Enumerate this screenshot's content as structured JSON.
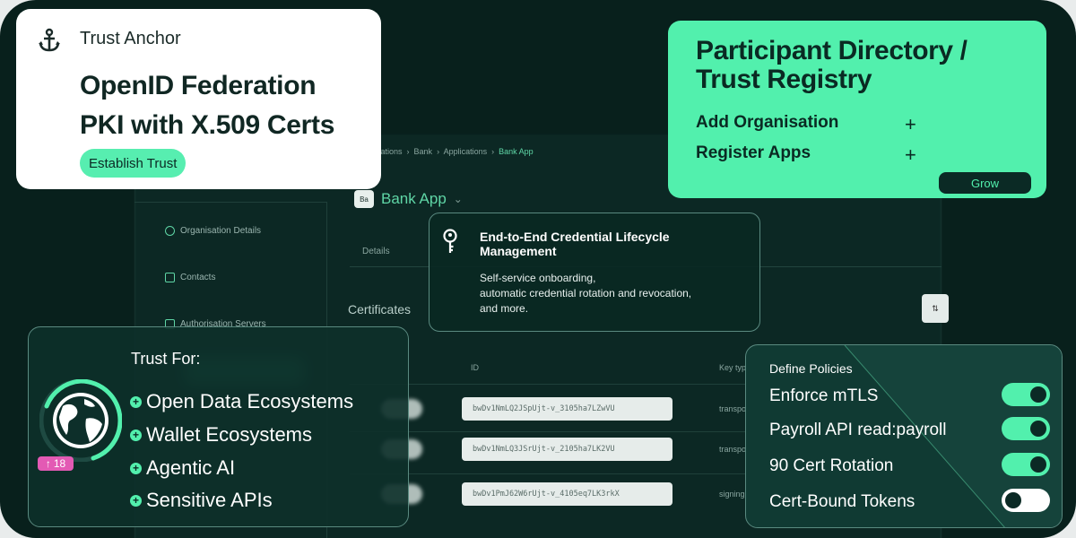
{
  "background_app": {
    "breadcrumb": [
      "Organisations",
      "Bank",
      "Applications",
      "Bank App"
    ],
    "app_badge": "Ba",
    "app_name": "Bank App",
    "sidebar": [
      "Organisation Details",
      "Contacts",
      "Authorisation Servers"
    ],
    "tabs": [
      "Details"
    ],
    "section_title": "Certificates",
    "table_headers": [
      "ID",
      "Key type"
    ],
    "rows": [
      {
        "id": "bwDv1NmLQ2JSpUjt-v_3105ha7LZwVU",
        "type": "transport"
      },
      {
        "id": "bwDv1NmLQ3JSrUjt-v_2105ha7LK2VU",
        "type": "transport"
      },
      {
        "id": "bwDv1PmJ62W6rUjt-v_4105eq7LK3rkX",
        "type": "signing"
      }
    ]
  },
  "trust_anchor": {
    "label": "Trust Anchor",
    "title_line1": "OpenID Federation",
    "title_line2": "PKI with X.509 Certs",
    "button": "Establish Trust"
  },
  "directory": {
    "title_line1": "Participant Directory /",
    "title_line2": "Trust Registry",
    "items": [
      {
        "label": "Add Organisation",
        "action": "+"
      },
      {
        "label": "Register Apps",
        "action": "+"
      }
    ],
    "button": "Grow"
  },
  "lifecycle": {
    "title": "End-to-End Credential Lifecycle Management",
    "desc_line1": "Self-service onboarding,",
    "desc_line2": "automatic credential rotation and revocation,",
    "desc_line3": "and more."
  },
  "trust_for": {
    "heading": "Trust For:",
    "items": [
      "Open Data Ecosystems",
      "Wallet Ecosystems",
      "Agentic AI",
      "Sensitive APIs"
    ],
    "badge_count": "18"
  },
  "policies": {
    "heading": "Define Policies",
    "items": [
      {
        "label": "Enforce mTLS",
        "enabled": true
      },
      {
        "label": "Payroll API read:payroll",
        "enabled": true
      },
      {
        "label": "90 Cert Rotation",
        "enabled": true
      },
      {
        "label": "Cert-Bound Tokens",
        "enabled": false
      }
    ]
  },
  "colors": {
    "background": "#08201c",
    "accent_green": "#52f0ad",
    "card_white": "#ffffff",
    "badge_pink": "#e35ab4"
  }
}
